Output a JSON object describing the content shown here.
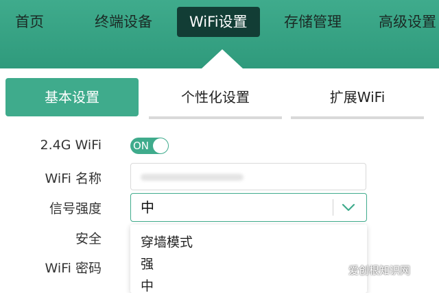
{
  "nav": {
    "items": [
      "首页",
      "终端设备",
      "WiFi设置",
      "存储管理",
      "高级设置"
    ],
    "active": "WiFi设置"
  },
  "tabs": [
    "基本设置",
    "个性化设置",
    "扩展WiFi"
  ],
  "form": {
    "wifi_24g_label": "2.4G WiFi",
    "toggle_text": "ON",
    "ssid_label": "WiFi 名称",
    "signal_label": "信号强度",
    "signal_value": "中",
    "security_label": "安全",
    "password_label": "WiFi 密码"
  },
  "dropdown": {
    "options": [
      "穿墙模式",
      "强",
      "中"
    ]
  },
  "watermark": "爱创根知识网",
  "colors": {
    "accent": "#3fab8c",
    "nav_active_bg": "#123d35"
  }
}
